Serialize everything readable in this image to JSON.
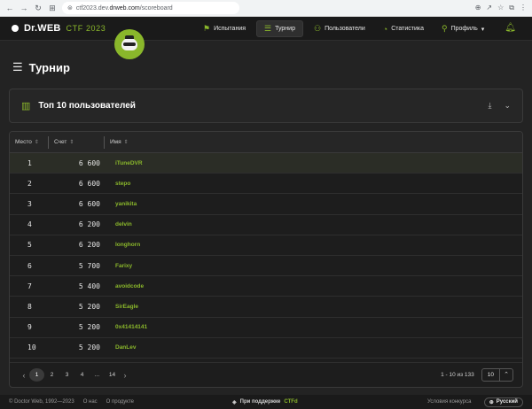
{
  "browser": {
    "url_path_pre": "ctf2023.dev.",
    "url_domain": "drweb.com",
    "url_path_post": "/scoreboard"
  },
  "app": {
    "brand": "Dr.WEB",
    "brand_suffix": "CTF 2023",
    "accent_color": "#8ab72b"
  },
  "nav": [
    {
      "label": "Испытания",
      "icon": "flag-icon",
      "active": false
    },
    {
      "label": "Турнир",
      "icon": "list-icon",
      "active": true
    },
    {
      "label": "Пользователи",
      "icon": "users-icon",
      "active": false
    },
    {
      "label": "Статистика",
      "icon": "pie-chart-icon",
      "active": false
    },
    {
      "label": "Профиль",
      "icon": "user-icon",
      "active": false
    }
  ],
  "page": {
    "title": "Турнир",
    "top_card_title": "Топ 10 пользователей"
  },
  "table": {
    "headers": [
      "Место",
      "Счет",
      "Имя"
    ],
    "rows": [
      {
        "rank": "1",
        "score": "6 600",
        "name": "iTuneDVR"
      },
      {
        "rank": "2",
        "score": "6 600",
        "name": "stepo"
      },
      {
        "rank": "3",
        "score": "6 600",
        "name": "yanikita"
      },
      {
        "rank": "4",
        "score": "6 200",
        "name": "delvin"
      },
      {
        "rank": "5",
        "score": "6 200",
        "name": "longhorn"
      },
      {
        "rank": "6",
        "score": "5 700",
        "name": "Farixy"
      },
      {
        "rank": "7",
        "score": "5 400",
        "name": "avoidcode"
      },
      {
        "rank": "8",
        "score": "5 200",
        "name": "SirEagle"
      },
      {
        "rank": "9",
        "score": "5 200",
        "name": "0x41414141"
      },
      {
        "rank": "10",
        "score": "5 200",
        "name": "DanLev"
      }
    ]
  },
  "pager": {
    "pages": [
      "1",
      "2",
      "3",
      "4",
      "...",
      "14"
    ],
    "active_page": "1",
    "info": "1 - 10 из 133",
    "per_page": "10"
  },
  "footer": {
    "copyright": "© Doctor Web, 1992—2023",
    "about": "О нас",
    "about_product": "О продукте",
    "support_prefix": "При поддержке",
    "support_brand": "CTFd",
    "rules": "Условия конкурса",
    "language": "Русский"
  }
}
